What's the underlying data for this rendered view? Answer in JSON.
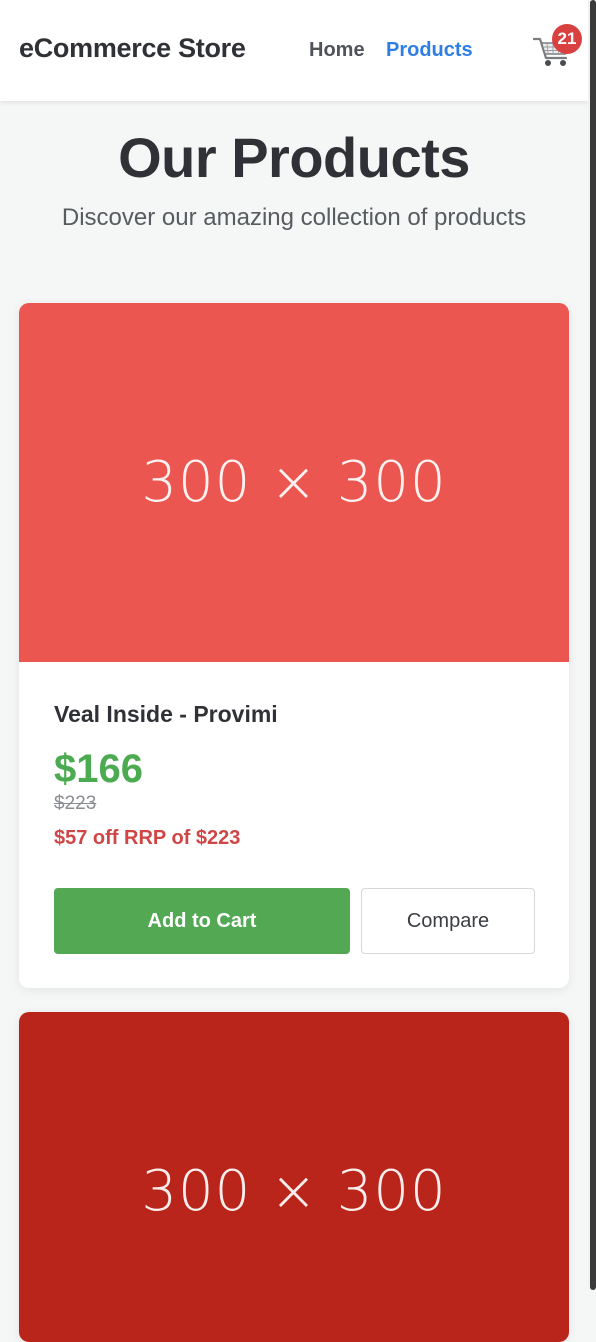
{
  "header": {
    "brand": "eCommerce Store",
    "nav": [
      {
        "label": "Home",
        "active": false
      },
      {
        "label": "Products",
        "active": true
      }
    ],
    "cart": {
      "icon": "shopping-cart-icon",
      "count": "21"
    }
  },
  "hero": {
    "title": "Our Products",
    "subtitle": "Discover our amazing collection of products"
  },
  "products": [
    {
      "image_label": "300 × 300",
      "image_color": "#ec5650",
      "name": "Veal Inside - Provimi",
      "price": "$166",
      "old_price": "$223",
      "discount": "$57 off RRP of $223",
      "add_to_cart_label": "Add to Cart",
      "compare_label": "Compare"
    },
    {
      "image_label": "300 × 300",
      "image_color": "#b9251b"
    }
  ],
  "colors": {
    "accent": "#2f7ee6",
    "price": "#4caa51",
    "discount": "#d04545",
    "add_to_cart": "#52a853",
    "badge": "#d94040"
  }
}
